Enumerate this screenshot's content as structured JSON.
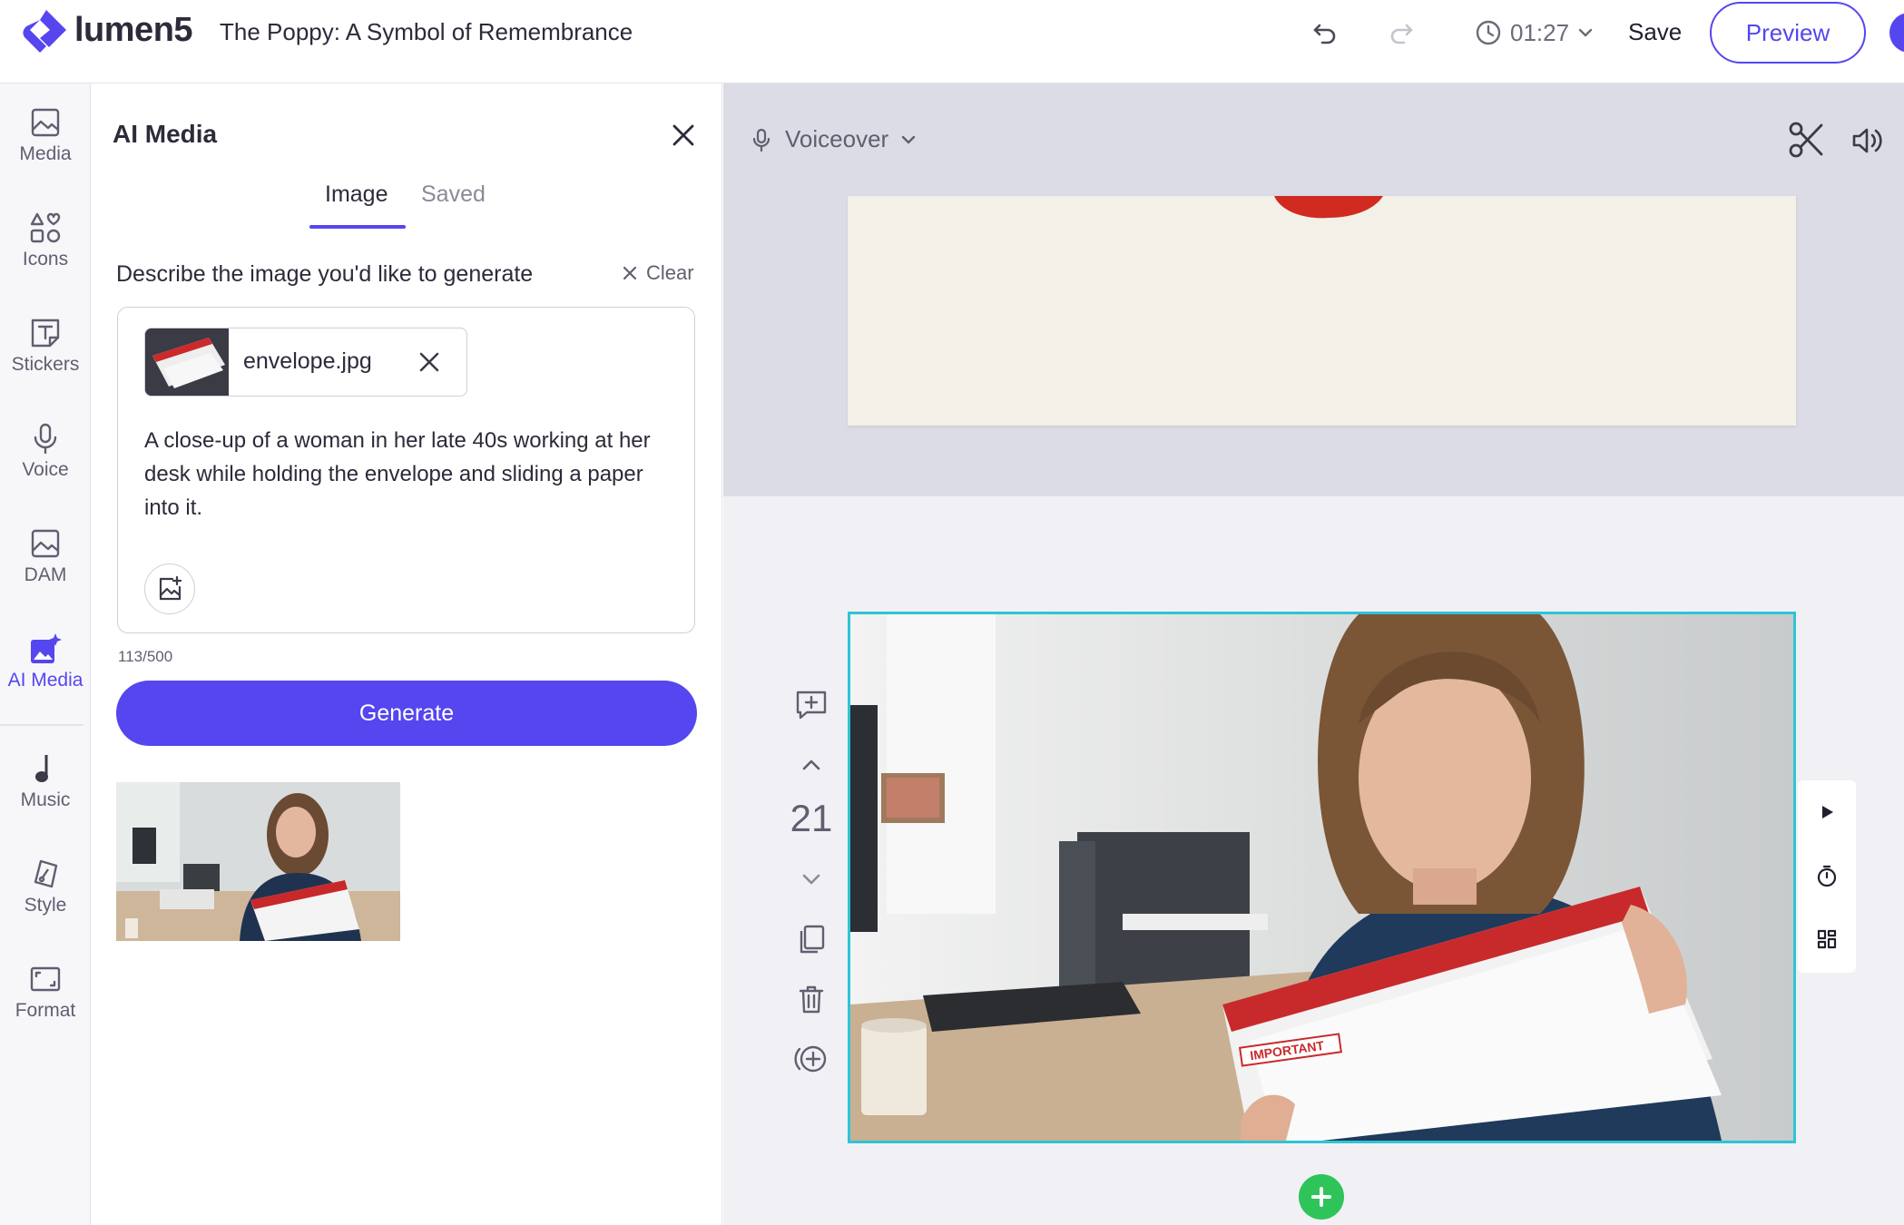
{
  "app": {
    "brand": "lumen5",
    "document_title": "The Poppy: A Symbol of Remembrance",
    "duration": "01:27",
    "save_label": "Save",
    "preview_label": "Preview",
    "accent_color": "#5546f0"
  },
  "rail": {
    "items": [
      {
        "label": "Media",
        "icon": "image-icon"
      },
      {
        "label": "Icons",
        "icon": "shapes-icon"
      },
      {
        "label": "Stickers",
        "icon": "text-sticker-icon"
      },
      {
        "label": "Voice",
        "icon": "microphone-icon"
      },
      {
        "label": "DAM",
        "icon": "image-icon"
      },
      {
        "label": "AI Media",
        "icon": "ai-image-icon",
        "active": true
      },
      {
        "label": "Music",
        "icon": "music-note-icon"
      },
      {
        "label": "Style",
        "icon": "brush-icon"
      },
      {
        "label": "Format",
        "icon": "aspect-ratio-icon"
      }
    ]
  },
  "panel": {
    "title": "AI Media",
    "tabs": [
      {
        "label": "Image",
        "active": true
      },
      {
        "label": "Saved",
        "active": false
      }
    ],
    "describe_label": "Describe the image you'd like to generate",
    "clear_label": "Clear",
    "attachment": {
      "file_name": "envelope.jpg"
    },
    "prompt_text": "A close-up of a woman in her late 40s working at her desk while holding the envelope and sliding a paper into it.",
    "char_count": "113/500",
    "generate_label": "Generate"
  },
  "canvas": {
    "voiceover_label": "Voiceover",
    "scene_number": "21",
    "envelope_stamp": "IMPORTANT",
    "selection_color": "#2ec4d6",
    "add_color": "#2ec45a"
  }
}
